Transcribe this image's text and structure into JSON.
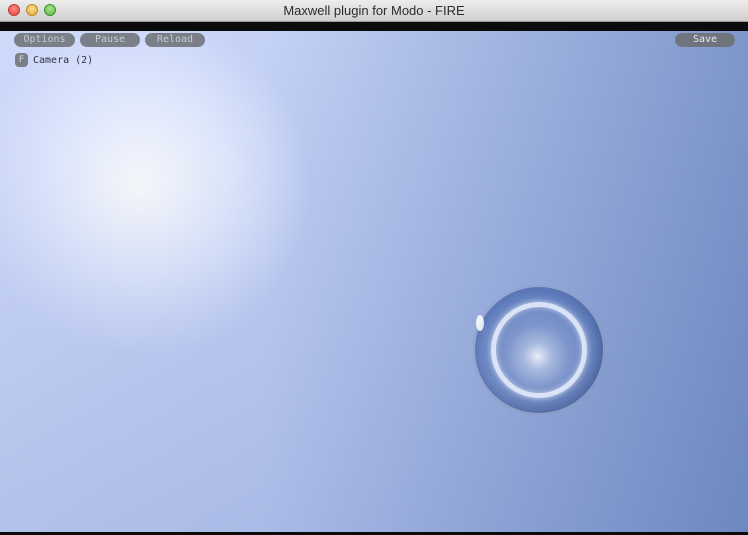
{
  "window": {
    "title": "Maxwell plugin for Modo - FIRE"
  },
  "toolbar": {
    "options_label": "Options",
    "pause_label": "Pause",
    "reload_label": "Reload",
    "save_label": "Save"
  },
  "camera": {
    "badge": "F",
    "label": "Camera (2)"
  },
  "colors": {
    "titlebar": "#dcdcdc",
    "pill_bg": "#7a7f88",
    "sky_light": "#ffffff",
    "sky_dark": "#7891c8",
    "sphere": "#6c87c3"
  },
  "icons": {
    "close": "close-button-icon",
    "minimize": "minimize-button-icon",
    "maximize": "zoom-button-icon"
  }
}
